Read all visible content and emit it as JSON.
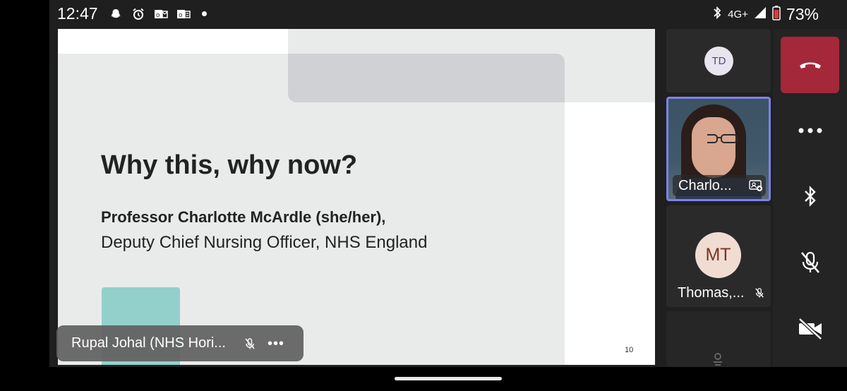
{
  "status_bar": {
    "time": "12:47",
    "network": "4G+",
    "battery": "73%",
    "icons": [
      "snapchat-icon",
      "alarm-icon",
      "outlook-icon",
      "office-icon",
      "bluetooth-icon",
      "signal-icon",
      "battery-icon"
    ]
  },
  "slide": {
    "title": "Why this, why now?",
    "speaker": "Professor Charlotte McArdle (she/her),",
    "role": "Deputy Chief Nursing Officer, NHS England",
    "page_number": "10"
  },
  "presenter": {
    "name": "Rupal Johal (NHS Hori..."
  },
  "participants": [
    {
      "initials": "TD"
    },
    {
      "name": "Charlo..."
    },
    {
      "initials": "MT",
      "name": "Thomas,..."
    }
  ],
  "controls": [
    "hang-up",
    "more-options",
    "bluetooth-audio",
    "microphone-off",
    "camera-off"
  ],
  "colors": {
    "hangup": "#a4283a",
    "active_speaker_border": "#7b83eb",
    "slide_band": "#e9ebeb",
    "slide_accent_teal": "#93d0cb"
  }
}
